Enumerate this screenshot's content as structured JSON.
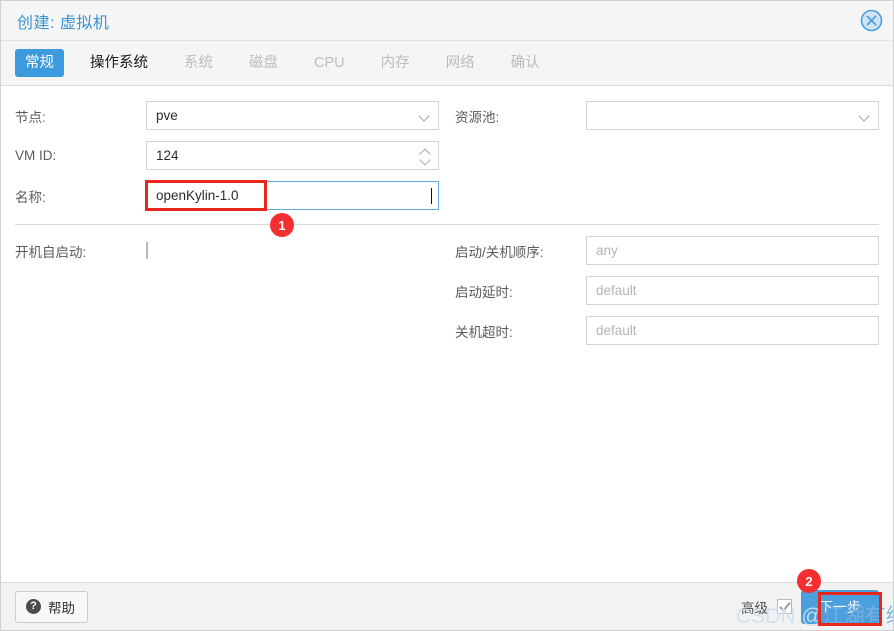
{
  "window": {
    "title": "创建: 虚拟机",
    "close_icon": "close-circle-icon"
  },
  "tabs": [
    {
      "label": "常规",
      "state": "active"
    },
    {
      "label": "操作系统",
      "state": "enabled"
    },
    {
      "label": "系统",
      "state": "disabled"
    },
    {
      "label": "磁盘",
      "state": "disabled"
    },
    {
      "label": "CPU",
      "state": "disabled"
    },
    {
      "label": "内存",
      "state": "disabled"
    },
    {
      "label": "网络",
      "state": "disabled"
    },
    {
      "label": "确认",
      "state": "disabled"
    }
  ],
  "form": {
    "node": {
      "label": "节点:",
      "value": "pve",
      "control": "combobox"
    },
    "vmid": {
      "label": "VM ID:",
      "value": "124",
      "control": "spinner"
    },
    "name": {
      "label": "名称:",
      "value": "openKylin-1.0",
      "control": "textfield",
      "focused": true
    },
    "resource_pool": {
      "label": "资源池:",
      "value": "",
      "control": "combobox"
    },
    "autostart": {
      "label": "开机自启动:",
      "checked": false,
      "control": "checkbox"
    },
    "start_order": {
      "label": "启动/关机顺序:",
      "placeholder": "any",
      "value": "",
      "control": "textfield"
    },
    "startup_delay": {
      "label": "启动延时:",
      "placeholder": "default",
      "value": "",
      "control": "textfield"
    },
    "shutdown_timeout": {
      "label": "关机超时:",
      "placeholder": "default",
      "value": "",
      "control": "textfield"
    }
  },
  "footer": {
    "help_label": "帮助",
    "help_icon": "question-mark-icon",
    "advanced_label": "高级",
    "advanced_checked": true,
    "next_label": "下一步"
  },
  "annotations": {
    "badge_one": "1",
    "badge_two": "2"
  },
  "watermark": {
    "text_gray": "CSDN @",
    "text_blue": "江湖有缘"
  },
  "colors": {
    "accent_blue": "#3c9ade",
    "title_blue": "#3892d4",
    "annotation_red": "#e8261c",
    "badge_red": "#f42f32"
  }
}
